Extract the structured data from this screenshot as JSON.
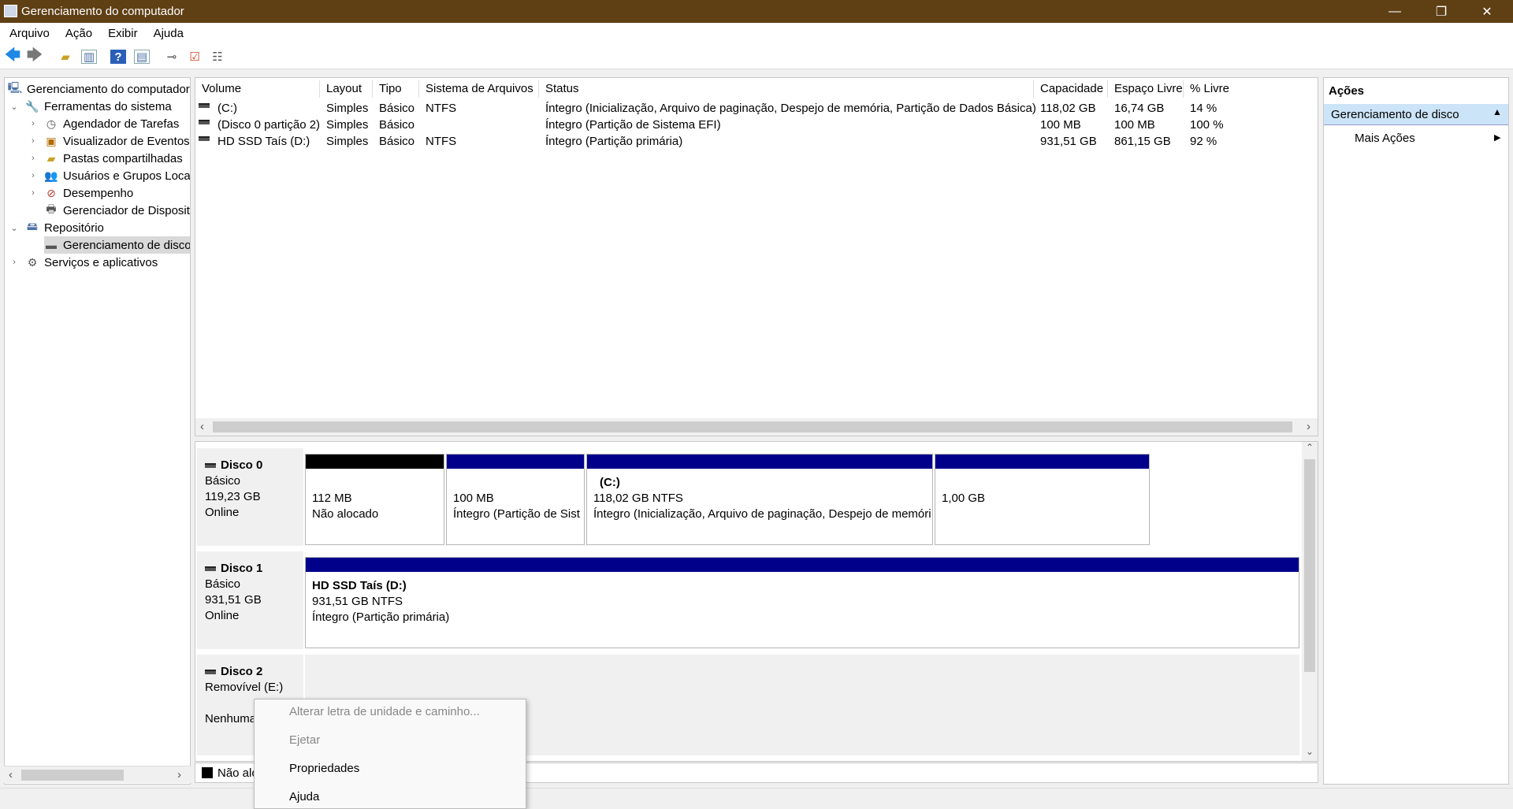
{
  "window": {
    "title": "Gerenciamento do computador",
    "minimize": "—",
    "restore": "❐",
    "close": "✕"
  },
  "menu": [
    "Arquivo",
    "Ação",
    "Exibir",
    "Ajuda"
  ],
  "tree": {
    "root": "Gerenciamento do computador",
    "items": [
      {
        "label": "Ferramentas do sistema"
      },
      {
        "label": "Agendador de Tarefas"
      },
      {
        "label": "Visualizador de Eventos"
      },
      {
        "label": "Pastas compartilhadas"
      },
      {
        "label": "Usuários e Grupos Locai"
      },
      {
        "label": "Desempenho"
      },
      {
        "label": "Gerenciador de Disposit"
      },
      {
        "label": "Repositório"
      },
      {
        "label": "Gerenciamento de disco"
      },
      {
        "label": "Serviços e aplicativos"
      }
    ]
  },
  "volume_table": {
    "headers": [
      "Volume",
      "Layout",
      "Tipo",
      "Sistema de Arquivos",
      "Status",
      "Capacidade",
      "Espaço Livre",
      "% Livre"
    ],
    "rows": [
      [
        "(C:)",
        "Simples",
        "Básico",
        "NTFS",
        "Íntegro (Inicialização, Arquivo de paginação, Despejo de memória, Partição de Dados Básica)",
        "118,02 GB",
        "16,74 GB",
        "14 %"
      ],
      [
        "(Disco 0 partição 2)",
        "Simples",
        "Básico",
        "",
        "Íntegro (Partição de Sistema EFI)",
        "100 MB",
        "100 MB",
        "100 %"
      ],
      [
        "HD SSD Taís (D:)",
        "Simples",
        "Básico",
        "NTFS",
        "Íntegro (Partição primária)",
        "931,51 GB",
        "861,15 GB",
        "92 %"
      ]
    ]
  },
  "disks": [
    {
      "name": "Disco 0",
      "type": "Básico",
      "size": "119,23 GB",
      "state": "Online",
      "partitions": [
        {
          "line1": "112 MB",
          "line2": "Não alocado"
        },
        {
          "line1": "100 MB",
          "line2": "Íntegro (Partição de Sist"
        },
        {
          "name": "(C:)",
          "line1": "118,02 GB NTFS",
          "line2": "Íntegro (Inicialização, Arquivo de paginação, Despejo de memóri"
        },
        {
          "line1": "1,00 GB"
        }
      ]
    },
    {
      "name": "Disco 1",
      "type": "Básico",
      "size": "931,51 GB",
      "state": "Online",
      "partitions": [
        {
          "name": "HD SSD Taís  (D:)",
          "line1": "931,51 GB NTFS",
          "line2": "Íntegro (Partição primária)"
        }
      ]
    },
    {
      "name": "Disco 2",
      "type": "Removível (E:)",
      "state": "Nenhuma"
    }
  ],
  "legend": {
    "label": "Não alo"
  },
  "actions": {
    "header": "Ações",
    "section": "Gerenciamento de disco",
    "more": "Mais Ações"
  },
  "context_menu": [
    {
      "label": "Alterar letra de unidade e caminho..."
    },
    {
      "label": "Ejetar"
    },
    {
      "label": "Propriedades"
    },
    {
      "label": "Ajuda"
    }
  ],
  "colors": {
    "titlebar": "#5f3f14",
    "unallocated": "#000000",
    "primary": "#00008b",
    "selection": "#cce4f7"
  }
}
